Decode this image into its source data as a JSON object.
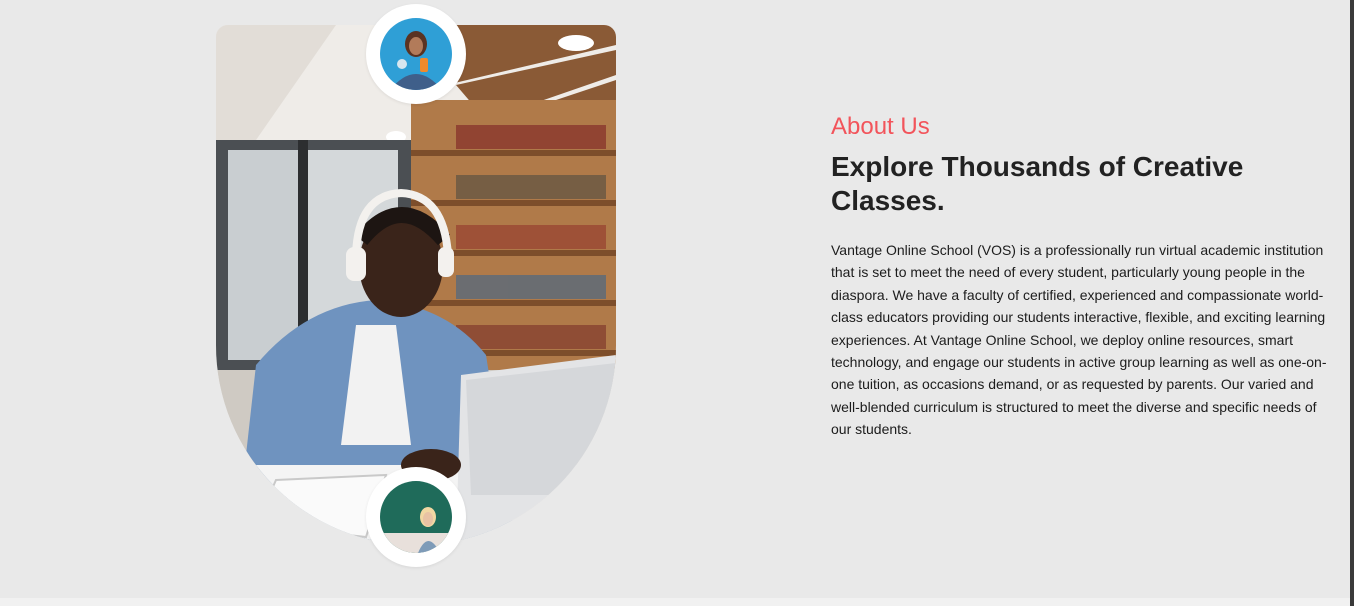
{
  "about": {
    "label": "About Us",
    "headline": "Explore Thousands of Creative Classes.",
    "body": "Vantage Online School (VOS) is a professionally run virtual academic institution that is set to meet the need of every student, particularly young people in the diaspora. We have a faculty of certified, experienced and compassionate world-class educators providing our students interactive, flexible, and exciting learning experiences. At Vantage Online School, we deploy online resources, smart technology, and engage our students in active group learning as well as one-on-one tuition, as occasions demand, or as requested by parents. Our varied and well-blended curriculum is structured to meet the diverse and specific needs of our students."
  },
  "colors": {
    "accent": "#f2545b",
    "heading": "#222222",
    "background": "#e9e9e9"
  }
}
